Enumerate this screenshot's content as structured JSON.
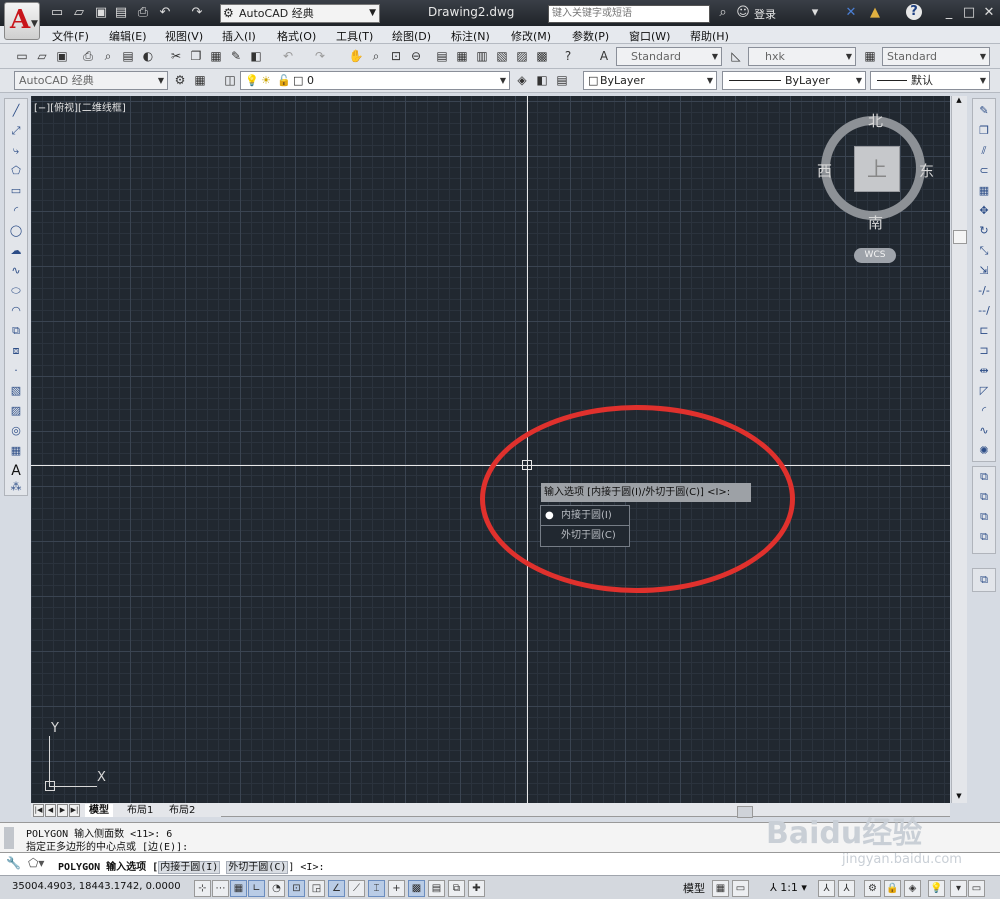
{
  "app": {
    "logo_letter": "A",
    "workspace": "AutoCAD 经典",
    "document_title": "Drawing2.dwg",
    "search_placeholder": "键入关键字或短语",
    "login_label": "登录",
    "help_label": "?"
  },
  "menu": {
    "items": [
      "文件(F)",
      "编辑(E)",
      "视图(V)",
      "插入(I)",
      "格式(O)",
      "工具(T)",
      "绘图(D)",
      "标注(N)",
      "修改(M)",
      "参数(P)",
      "窗口(W)",
      "帮助(H)"
    ]
  },
  "styles_toolbar": {
    "text_style": "Standard",
    "dim_style": "hxk",
    "table_style": "Standard"
  },
  "layers_toolbar": {
    "workspace": "AutoCAD 经典",
    "layer": "0",
    "color": "ByLayer",
    "linetype": "ByLayer",
    "lineweight": "默认"
  },
  "viewport": {
    "label": "[−][俯视][二维线框]",
    "viewcube": {
      "north": "北",
      "south": "南",
      "east": "东",
      "west": "西",
      "face": "上",
      "wcs": "WCS"
    },
    "ucs_x": "X",
    "ucs_y": "Y"
  },
  "dynamic_input": {
    "prompt": "输入选项 [内接于圆(I)/外切于圆(C)] <I>:",
    "options": [
      {
        "label": "内接于圆(I)",
        "selected": true
      },
      {
        "label": "外切于圆(C)",
        "selected": false
      }
    ],
    "bullet": "●"
  },
  "layout_tabs": [
    "模型",
    "布局1",
    "布局2"
  ],
  "command": {
    "history_line1": "POLYGON 输入侧面数 <11>: 6",
    "history_line2": "指定正多边形的中心点或 [边(E)]:",
    "current_prefix": "POLYGON 输入选项 [",
    "current_opt1": "内接于圆(I)",
    "current_opt2": "外切于圆(C)",
    "current_suffix": "] <I>:"
  },
  "status": {
    "coordinates": "35004.4903, 18443.1742, 0.0000",
    "model_label": "模型",
    "annotation_scale": "1:1"
  },
  "watermark": {
    "text": "Baidu经验",
    "url_text": "jingyan.baidu.com"
  },
  "colors": {
    "canvas": "#212830",
    "highlight_ellipse": "#e0312d",
    "logo_red": "#c8151b"
  }
}
